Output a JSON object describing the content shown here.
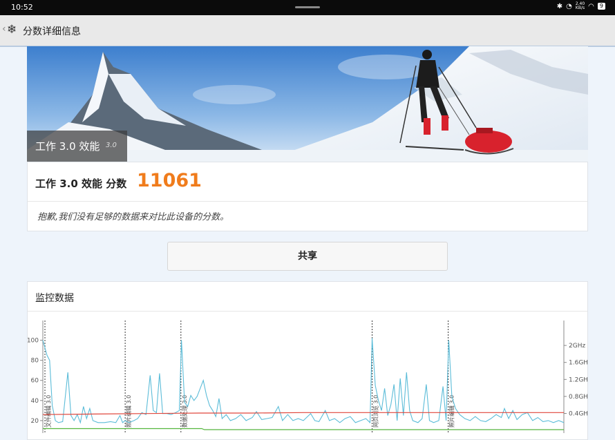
{
  "status_bar": {
    "time": "10:52",
    "icons": [
      "bluetooth-icon",
      "data-saver-icon",
      "wifi-icon",
      "battery-icon"
    ],
    "network_speed_value": "2.40",
    "network_speed_unit": "KB/s",
    "battery_level": "9"
  },
  "app_bar": {
    "back_icon": "chevron-left-icon",
    "logo_icon": "snowflake-icon",
    "title": "分数详细信息"
  },
  "benchmark": {
    "name": "工作 3.0 效能",
    "version": "3.0",
    "score_label": "工作 3.0 效能 分数",
    "score_value": "11061",
    "note": "抱歉,我们没有足够的数据来对比此设备的分数。"
  },
  "share": {
    "label": "共享"
  },
  "monitoring": {
    "title": "监控数据"
  },
  "colors": {
    "score": "#f07c1c",
    "cpu_load_line": "#5bbcd8",
    "temperature_line": "#e0453a",
    "frequency_line": "#53b53d"
  },
  "chart_data": {
    "type": "line",
    "y_left_ticks": [
      20,
      40,
      60,
      80,
      100
    ],
    "y_left_range": [
      0,
      110
    ],
    "y_right_ticks": [
      "0.4GH",
      "0.8GH",
      "1.2GH",
      "1.6GH",
      "2GHz"
    ],
    "y_right_values": [
      0.4,
      0.8,
      1.2,
      1.6,
      2.0
    ],
    "y_right_range": [
      0,
      2.25
    ],
    "x_range": [
      0,
      100
    ],
    "markers": [
      {
        "x": 0.4,
        "label": "文件编辑 3.0"
      },
      {
        "x": 15.8,
        "label": "照片编辑 3.0"
      },
      {
        "x": 26.5,
        "label": "数据处理 3.0"
      },
      {
        "x": 63.2,
        "label": "网页浏览 3.0"
      },
      {
        "x": 77.8,
        "label": "照片编辑 3.0"
      }
    ],
    "series": [
      {
        "values": [
          [
            0,
            100
          ],
          [
            0.8,
            85
          ],
          [
            1.3,
            80
          ],
          [
            1.8,
            35
          ],
          [
            2.4,
            20
          ],
          [
            3.0,
            18
          ],
          [
            3.8,
            19
          ],
          [
            4.8,
            68
          ],
          [
            5.4,
            25
          ],
          [
            6.0,
            20
          ],
          [
            6.6,
            26
          ],
          [
            7.2,
            18
          ],
          [
            7.8,
            34
          ],
          [
            8.4,
            22
          ],
          [
            9.0,
            32
          ],
          [
            9.6,
            20
          ],
          [
            10.6,
            18
          ],
          [
            11.8,
            18
          ],
          [
            13,
            19
          ],
          [
            14,
            18
          ],
          [
            14.8,
            25
          ],
          [
            15.3,
            18
          ],
          [
            15.8,
            20
          ],
          [
            16.5,
            18
          ],
          [
            17.5,
            20
          ],
          [
            18.2,
            22
          ],
          [
            19,
            28
          ],
          [
            19.8,
            26
          ],
          [
            20.6,
            65
          ],
          [
            21.2,
            30
          ],
          [
            21.8,
            28
          ],
          [
            22.4,
            67
          ],
          [
            23,
            27
          ],
          [
            23.8,
            27
          ],
          [
            24.6,
            26
          ],
          [
            25.5,
            28
          ],
          [
            26.2,
            30
          ],
          [
            26.6,
            100
          ],
          [
            27.2,
            38
          ],
          [
            27.8,
            34
          ],
          [
            28.4,
            45
          ],
          [
            29.0,
            40
          ],
          [
            29.6,
            44
          ],
          [
            30.2,
            52
          ],
          [
            30.8,
            60
          ],
          [
            31.4,
            45
          ],
          [
            32,
            35
          ],
          [
            32.6,
            30
          ],
          [
            33.2,
            24
          ],
          [
            33.8,
            42
          ],
          [
            34.4,
            22
          ],
          [
            35.2,
            26
          ],
          [
            36.0,
            20
          ],
          [
            37,
            22
          ],
          [
            38,
            26
          ],
          [
            39,
            20
          ],
          [
            40.2,
            23
          ],
          [
            41.0,
            29
          ],
          [
            42,
            21
          ],
          [
            43,
            22
          ],
          [
            44,
            23
          ],
          [
            45.2,
            34
          ],
          [
            46,
            20
          ],
          [
            47,
            26
          ],
          [
            48,
            20
          ],
          [
            49,
            22
          ],
          [
            50,
            20
          ],
          [
            51.4,
            27
          ],
          [
            52.2,
            20
          ],
          [
            53,
            19
          ],
          [
            54.2,
            30
          ],
          [
            55,
            20
          ],
          [
            56,
            22
          ],
          [
            57,
            18
          ],
          [
            58,
            22
          ],
          [
            59,
            24
          ],
          [
            60,
            18
          ],
          [
            61,
            20
          ],
          [
            62,
            22
          ],
          [
            62.8,
            18
          ],
          [
            63.2,
            102
          ],
          [
            63.8,
            55
          ],
          [
            64.4,
            40
          ],
          [
            65,
            30
          ],
          [
            65.6,
            52
          ],
          [
            66.2,
            25
          ],
          [
            66.8,
            36
          ],
          [
            67.4,
            56
          ],
          [
            68.0,
            20
          ],
          [
            68.6,
            62
          ],
          [
            69.2,
            25
          ],
          [
            69.8,
            68
          ],
          [
            70.4,
            30
          ],
          [
            71,
            20
          ],
          [
            72,
            18
          ],
          [
            72.8,
            22
          ],
          [
            73.6,
            56
          ],
          [
            74.2,
            20
          ],
          [
            75,
            18
          ],
          [
            76,
            20
          ],
          [
            76.8,
            54
          ],
          [
            77.4,
            20
          ],
          [
            77.9,
            100
          ],
          [
            78.5,
            44
          ],
          [
            79.2,
            32
          ],
          [
            80,
            26
          ],
          [
            81,
            22
          ],
          [
            82,
            20
          ],
          [
            83,
            24
          ],
          [
            84,
            20
          ],
          [
            85,
            19
          ],
          [
            86,
            22
          ],
          [
            87,
            26
          ],
          [
            88,
            23
          ],
          [
            88.6,
            32
          ],
          [
            89.4,
            22
          ],
          [
            90.2,
            30
          ],
          [
            91,
            21
          ],
          [
            92,
            26
          ],
          [
            93,
            28
          ],
          [
            94,
            20
          ],
          [
            95,
            23
          ],
          [
            96,
            19
          ],
          [
            97,
            20
          ],
          [
            98,
            18
          ],
          [
            99,
            20
          ],
          [
            100,
            18
          ]
        ]
      },
      {
        "values": [
          [
            0,
            26
          ],
          [
            10,
            26.5
          ],
          [
            20,
            27
          ],
          [
            30,
            27.5
          ],
          [
            40,
            27.5
          ],
          [
            50,
            28
          ],
          [
            60,
            28
          ],
          [
            70,
            28
          ],
          [
            80,
            28
          ],
          [
            90,
            28
          ],
          [
            100,
            28
          ]
        ]
      },
      {
        "values": [
          [
            0,
            12
          ],
          [
            30.5,
            12
          ],
          [
            31,
            11
          ],
          [
            100,
            11
          ]
        ]
      }
    ]
  }
}
